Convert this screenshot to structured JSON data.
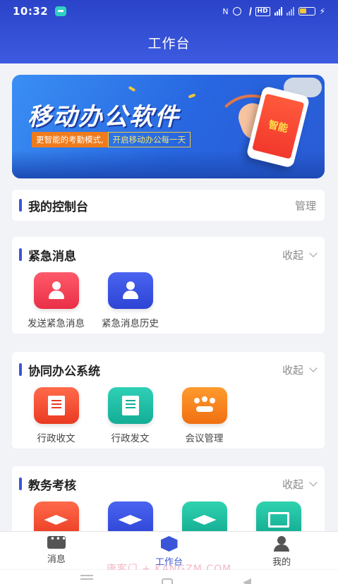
{
  "status_bar": {
    "time": "10:32",
    "indicators": [
      "nfc-icon",
      "alarm-icon",
      "bluetooth-icon",
      "hd-icon",
      "signal-icon",
      "battery-icon",
      "charging-icon"
    ],
    "hd_label": "HD"
  },
  "header": {
    "title": "工作台"
  },
  "banner": {
    "title": "移动办公软件",
    "subtitle_left": "更智能的考勤模式,",
    "subtitle_right": "开启移动办公每一天",
    "phone_text": "智能"
  },
  "console": {
    "title": "我的控制台",
    "action": "管理"
  },
  "emergency": {
    "title": "紧急消息",
    "action": "收起",
    "items": [
      {
        "label": "发送紧急消息",
        "icon": "send-emergency-icon",
        "color": "#e92f47"
      },
      {
        "label": "紧急消息历史",
        "icon": "emergency-history-icon",
        "color": "#2d44d4"
      }
    ]
  },
  "office": {
    "title": "协同办公系统",
    "action": "收起",
    "items": [
      {
        "label": "行政收文",
        "icon": "receive-document-icon",
        "color": "#ea3a22"
      },
      {
        "label": "行政发文",
        "icon": "send-document-icon",
        "color": "#14ad96"
      },
      {
        "label": "会议管理",
        "icon": "meeting-management-icon",
        "color": "#f07012"
      }
    ]
  },
  "academic": {
    "title": "教务考核",
    "action": "收起",
    "items": [
      {
        "icon": "graduation-cap-chart-icon",
        "color": "#ea3a22"
      },
      {
        "icon": "graduation-cap-edit-icon",
        "color": "#2d44d4"
      },
      {
        "icon": "graduation-cap-stats-icon",
        "color": "#11a88f"
      },
      {
        "icon": "monitor-chart-icon",
        "color": "#11a88f"
      }
    ]
  },
  "bottom_nav": {
    "items": [
      {
        "label": "消息",
        "icon": "message-icon",
        "active": false
      },
      {
        "label": "工作台",
        "icon": "workbench-icon",
        "active": true
      },
      {
        "label": "我的",
        "icon": "profile-icon",
        "active": false
      }
    ]
  },
  "watermark": "康客门 + KANGZM.COM",
  "colors": {
    "header": "#2a43c9",
    "accent": "#3b55d8",
    "background": "#f2f3f7"
  }
}
